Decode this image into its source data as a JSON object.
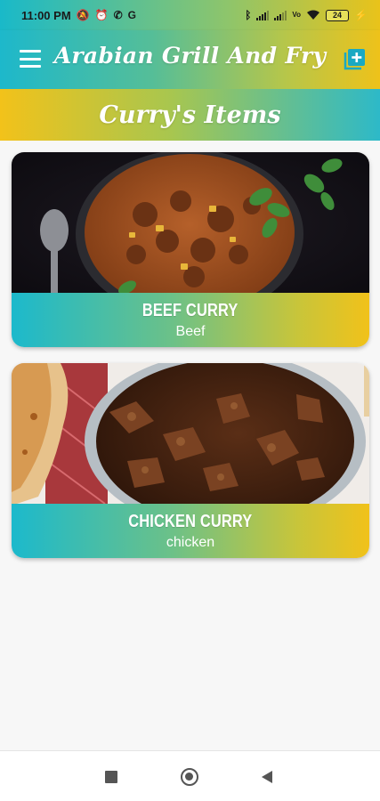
{
  "status_bar": {
    "time": "11:00 PM",
    "left_icons": [
      "notification-off-icon",
      "alarm-icon",
      "whatsapp-icon",
      "google-icon"
    ],
    "right_icons": [
      "bluetooth-icon",
      "signal-icon",
      "signal-icon",
      "vowifi-icon",
      "wifi-icon"
    ],
    "battery": "24"
  },
  "app_bar": {
    "title": "Arabian Grill And Fry",
    "menu_icon": "menu-icon",
    "action_icon": "add-box-icon"
  },
  "section": {
    "title": "Curry's Items"
  },
  "items": [
    {
      "name": "BEEF CURRY",
      "category": "Beef",
      "image": "beef-curry-photo"
    },
    {
      "name": "CHICKEN CURRY",
      "category": "chicken",
      "image": "chicken-curry-photo"
    }
  ],
  "nav_bar": {
    "buttons": [
      "recents-button",
      "home-button",
      "back-button"
    ]
  },
  "colors": {
    "gradient_teal": "#1db8cb",
    "gradient_yellow": "#eec21a",
    "background": "#f7f7f7"
  }
}
